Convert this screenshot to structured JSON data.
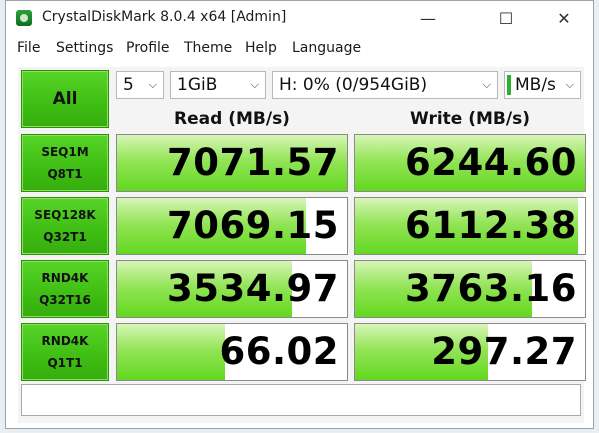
{
  "window": {
    "title": "CrystalDiskMark 8.0.4 x64 [Admin]"
  },
  "controls": {
    "minimize": "—",
    "maximize": "☐",
    "close": "✕"
  },
  "menu": [
    "File",
    "Settings",
    "Profile",
    "Theme",
    "Help",
    "Language"
  ],
  "toolbar": {
    "all_label": "All",
    "count": "5",
    "size": "1GiB",
    "drive": "H: 0% (0/954GiB)",
    "unit": "MB/s",
    "chevron": "⌵"
  },
  "headers": {
    "read": "Read (MB/s)",
    "write": "Write (MB/s)"
  },
  "tests": [
    {
      "line1": "SEQ1M",
      "line2": "Q8T1",
      "read": "7071.57",
      "write": "6244.60",
      "read_fill": 1.0,
      "write_fill": 1.0
    },
    {
      "line1": "SEQ128K",
      "line2": "Q32T1",
      "read": "7069.15",
      "write": "6112.38",
      "read_fill": 0.82,
      "write_fill": 0.97
    },
    {
      "line1": "RND4K",
      "line2": "Q32T16",
      "read": "3534.97",
      "write": "3763.16",
      "read_fill": 0.76,
      "write_fill": 0.77
    },
    {
      "line1": "RND4K",
      "line2": "Q1T1",
      "read": "66.02",
      "write": "297.27",
      "read_fill": 0.47,
      "write_fill": 0.58
    }
  ],
  "status_text": "",
  "colors": {
    "accent": "#40bf14",
    "bar": "#62d81f"
  }
}
